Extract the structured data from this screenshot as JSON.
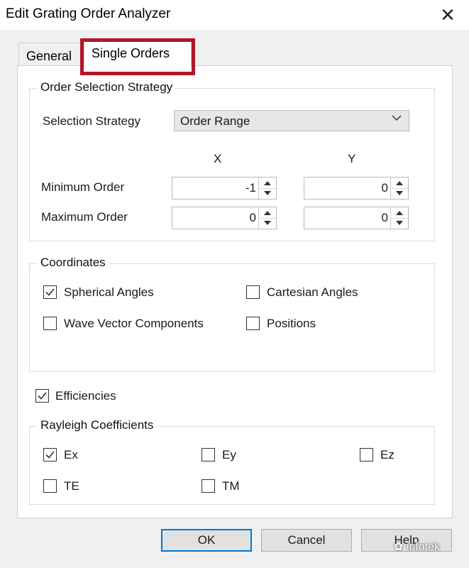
{
  "window": {
    "title": "Edit Grating Order Analyzer",
    "close_glyph": "✕"
  },
  "tabs": [
    {
      "label": "General"
    },
    {
      "label": "Single Orders",
      "selected": true
    }
  ],
  "highlight_color": "#b0162a",
  "order_selection": {
    "group_title": "Order Selection Strategy",
    "strategy_label": "Selection Strategy",
    "strategy_value": "Order Range",
    "col_x": "X",
    "col_y": "Y",
    "min_label": "Minimum Order",
    "max_label": "Maximum Order",
    "min_x": "-1",
    "min_y": "0",
    "max_x": "0",
    "max_y": "0"
  },
  "coordinates": {
    "group_title": "Coordinates",
    "options": [
      {
        "label": "Spherical Angles",
        "checked": true
      },
      {
        "label": "Cartesian Angles",
        "checked": false
      },
      {
        "label": "Wave Vector Components",
        "checked": false
      },
      {
        "label": "Positions",
        "checked": false
      }
    ]
  },
  "efficiencies": {
    "label": "Efficiencies",
    "checked": true
  },
  "rayleigh": {
    "group_title": "Rayleigh Coefficients",
    "options": [
      {
        "label": "Ex",
        "checked": true
      },
      {
        "label": "Ey",
        "checked": false
      },
      {
        "label": "Ez",
        "checked": false
      },
      {
        "label": "TE",
        "checked": false
      },
      {
        "label": "TM",
        "checked": false
      }
    ]
  },
  "buttons": {
    "ok": "OK",
    "cancel": "Cancel",
    "help": "Help"
  },
  "watermark": "infotek",
  "accent_color": "#0078d7"
}
